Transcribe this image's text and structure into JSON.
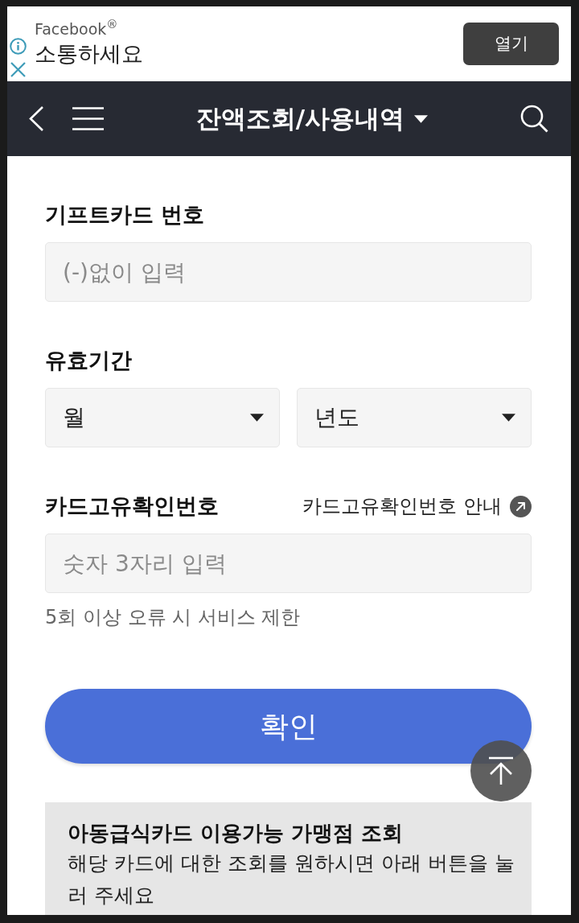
{
  "ad_banner": {
    "brand": "Facebook$^{®}$",
    "headline": "소통하세요",
    "open_button": "열기"
  },
  "header": {
    "title": "잔액조회/사용내역"
  },
  "sections": [
    {
      "kind": "input",
      "label": "기프트카드 번호",
      "placeholder": "(-)없이 입력"
    },
    {
      "kind": "selects",
      "label": "유효기간",
      "selects": [
        {
          "value": "월"
        },
        {
          "value": "년도"
        }
      ]
    },
    {
      "kind": "input",
      "label": "카드고유확인번호",
      "link": "카드고유확인번호 안내",
      "placeholder": "숫자 3자리 입력",
      "helper": "5회 이상 오류 시 서비스 제한"
    }
  ],
  "confirm_button": "확인",
  "info_box": {
    "title": "아동급식카드 이용가능 가맹점 조회",
    "description": "해당 카드에 대한 조회를 원하시면 아래 버튼을 눌러 주세요"
  }
}
